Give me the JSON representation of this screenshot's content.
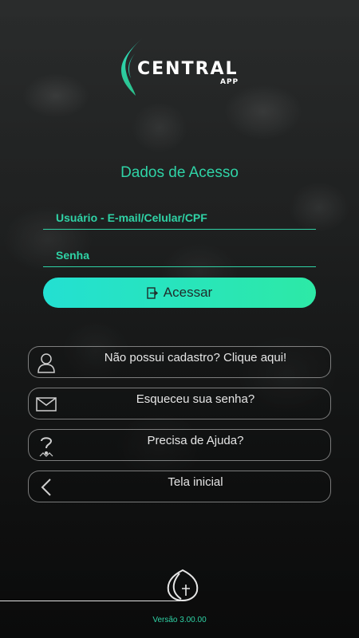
{
  "brand": {
    "name": "CENTRAL",
    "subtitle": "APP",
    "accent_color": "#2fd3a6"
  },
  "login": {
    "section_title": "Dados de Acesso",
    "user_placeholder": "Usuário - E-mail/Celular/CPF",
    "user_value": "",
    "password_placeholder": "Senha",
    "password_value": "",
    "submit_label": "Acessar",
    "submit_icon": "login-icon"
  },
  "links": [
    {
      "label": "Não possui cadastro? Clique aqui!",
      "icon": "user-icon"
    },
    {
      "label": "Esqueceu sua senha?",
      "icon": "mail-icon"
    },
    {
      "label": "Precisa de Ajuda?",
      "icon": "help-icon"
    },
    {
      "label": "Tela inicial",
      "icon": "back-arrow-icon"
    }
  ],
  "footer": {
    "version": "Versão 3.00.00",
    "icon": "footer-logo-icon"
  }
}
